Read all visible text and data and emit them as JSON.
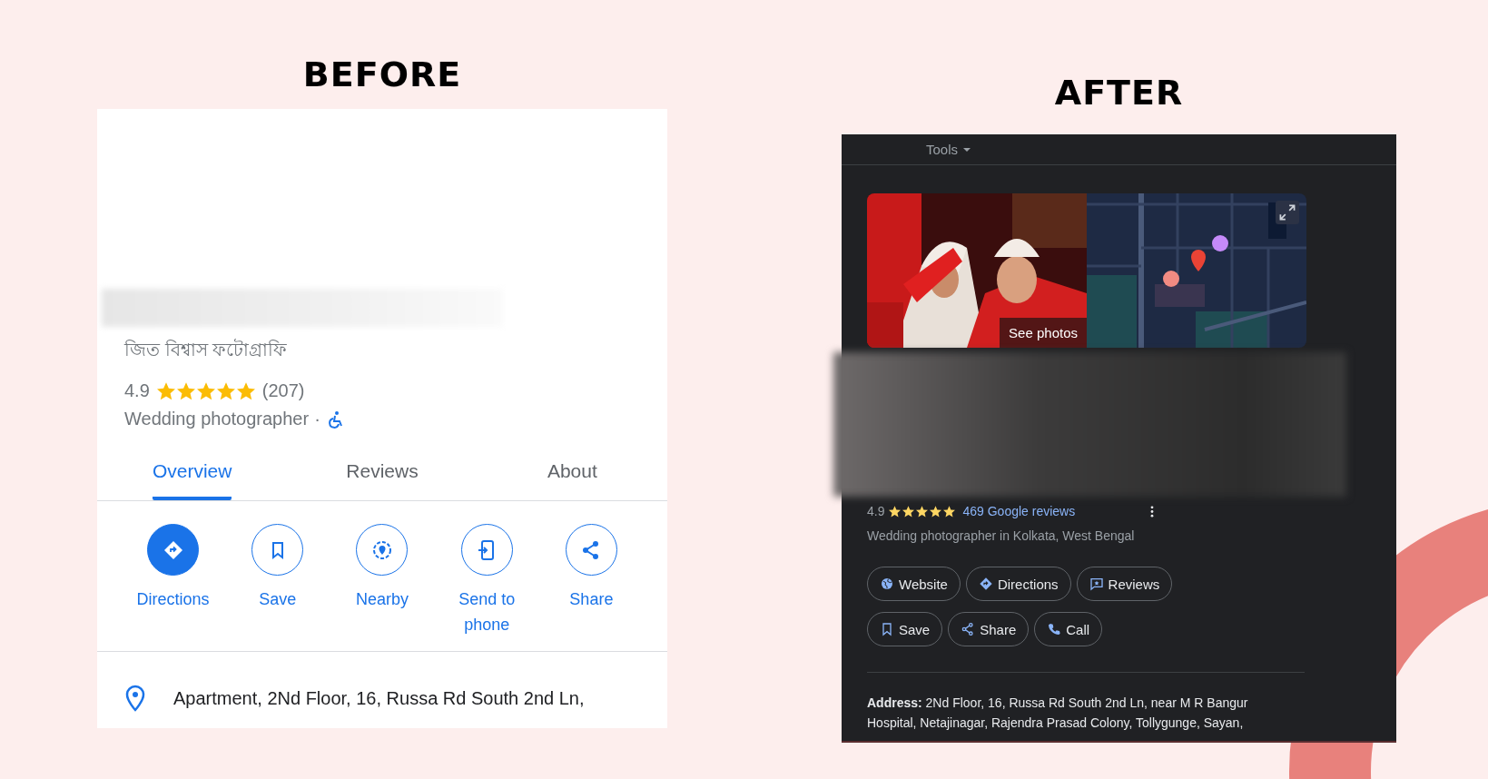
{
  "before": {
    "title": "BEFORE",
    "local_name": "জিত বিশ্বাস ফটোগ্রাফি",
    "rating": "4.9",
    "stars": 5,
    "review_count": "(207)",
    "category": "Wedding photographer",
    "separator": "·",
    "tabs": [
      {
        "label": "Overview",
        "selected": true
      },
      {
        "label": "Reviews",
        "selected": false
      },
      {
        "label": "About",
        "selected": false
      }
    ],
    "actions": [
      {
        "label": "Directions",
        "kind": "directions",
        "filled": true
      },
      {
        "label": "Save",
        "kind": "save",
        "filled": false
      },
      {
        "label": "Nearby",
        "kind": "nearby",
        "filled": false
      },
      {
        "label": "Send to phone",
        "kind": "send",
        "filled": false
      },
      {
        "label": "Share",
        "kind": "share",
        "filled": false
      }
    ],
    "address": "Apartment, 2Nd Floor, 16, Russa Rd South 2nd Ln,"
  },
  "after": {
    "title": "AFTER",
    "tools": "Tools",
    "see_photos": "See photos",
    "rating": "4.9",
    "stars": 5,
    "reviews_link": "469 Google reviews",
    "category": "Wedding photographer in Kolkata, West Bengal",
    "buttons": [
      {
        "label": "Website",
        "kind": "website"
      },
      {
        "label": "Directions",
        "kind": "directions"
      },
      {
        "label": "Reviews",
        "kind": "reviews"
      },
      {
        "label": "Save",
        "kind": "save"
      },
      {
        "label": "Share",
        "kind": "share"
      },
      {
        "label": "Call",
        "kind": "call"
      }
    ],
    "address": "**Address:** 2Nd Floor, 16, Russa Rd South 2nd Ln, near M R Bangur Hospital, Netajinagar, Rajendra Prasad Colony, Tollygunge, Sayan,"
  }
}
